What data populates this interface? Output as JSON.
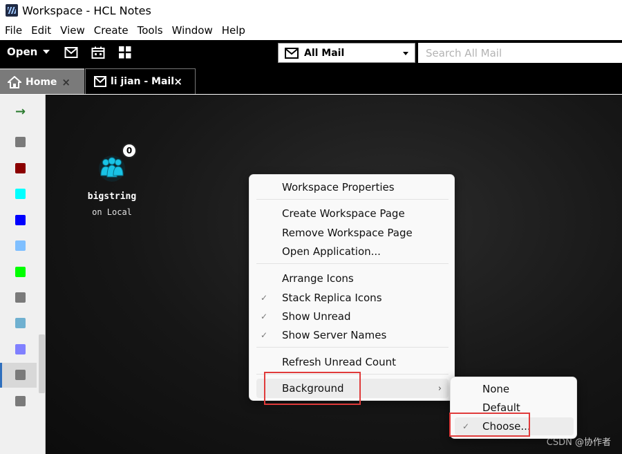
{
  "window": {
    "title": "Workspace - HCL Notes"
  },
  "menubar": [
    "File",
    "Edit",
    "View",
    "Create",
    "Tools",
    "Window",
    "Help"
  ],
  "toolbar": {
    "open_label": "Open",
    "mailbox_label": "All Mail",
    "search_placeholder": "Search All Mail",
    "icons": [
      "mail-icon",
      "calendar-icon",
      "apps-grid-icon"
    ]
  },
  "tabs": [
    {
      "label": "Home",
      "icon": "home-icon",
      "active": false
    },
    {
      "label": "li jian - Mail",
      "icon": "mail-icon",
      "active": true
    }
  ],
  "sidebar": {
    "arrow_icon": "arrow-right-icon",
    "colors": [
      "#7a7a7a",
      "#8b0000",
      "#00ffff",
      "#0000ff",
      "#7fbfff",
      "#00ff00",
      "#7a7a7a",
      "#6fb0d0",
      "#8080ff",
      "#7a7a7a",
      "#7a7a7a"
    ]
  },
  "workspace": {
    "tile": {
      "name": "bigstring",
      "location": "on Local",
      "unread": "0",
      "icon": "database-people-icon"
    },
    "watermark": "CSDN @协作者"
  },
  "context_menu": {
    "items": [
      {
        "label": "Workspace Properties"
      },
      {
        "label": "Create Workspace Page"
      },
      {
        "label": "Remove Workspace Page"
      },
      {
        "label": "Open Application..."
      },
      {
        "label": "Arrange Icons"
      },
      {
        "label": "Stack Replica Icons",
        "checked": true
      },
      {
        "label": "Show Unread",
        "checked": true
      },
      {
        "label": "Show Server Names",
        "checked": true
      },
      {
        "label": "Refresh Unread Count"
      },
      {
        "label": "Background",
        "submenu": true
      }
    ],
    "check_glyph": "✓",
    "submenu_arrow": "›"
  },
  "submenu": {
    "items": [
      {
        "label": "None"
      },
      {
        "label": "Default"
      },
      {
        "label": "Choose...",
        "checked": true
      }
    ]
  },
  "colors": {
    "highlight": "#e03a3a",
    "accent": "#2f6fbd",
    "db_icon": "#19c3e6"
  }
}
